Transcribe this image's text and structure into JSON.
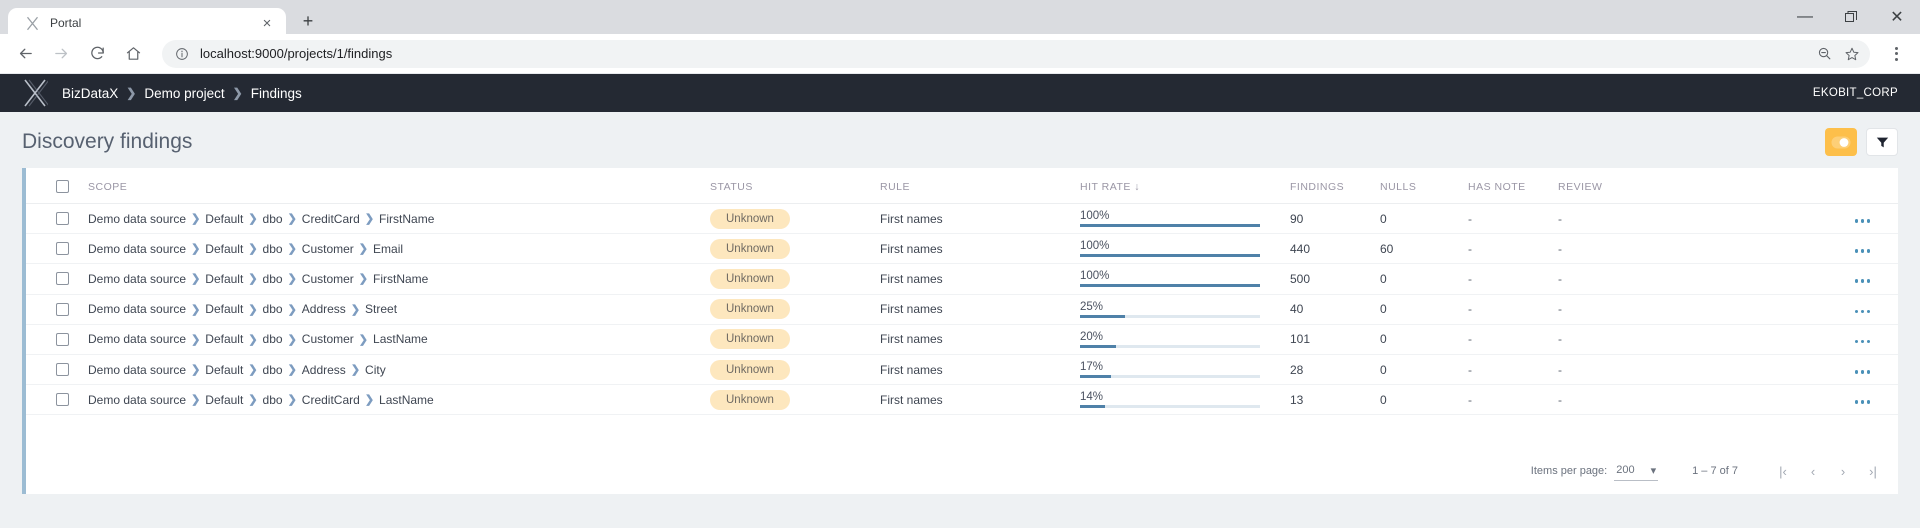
{
  "browser": {
    "tab_title": "Portal",
    "tab_favicon": "x-logo-icon",
    "close_tab_label": "×",
    "new_tab_label": "+",
    "url": "localhost:9000/projects/1/findings",
    "back_label": "←",
    "forward_label": "→",
    "reload_label": "⟳",
    "home_label": "⌂",
    "minimize_label": "—",
    "restore_label": "❐",
    "close_label": "✕"
  },
  "header": {
    "breadcrumb": [
      {
        "label": "BizDataX"
      },
      {
        "label": "Demo project"
      },
      {
        "label": "Findings"
      }
    ],
    "separator": "❯",
    "org": "EKOBIT_CORP"
  },
  "page": {
    "title": "Discovery findings",
    "toggle_button": "toggle-icon",
    "filter_button": "filter-icon",
    "accent_amber": "#fdbf4a",
    "accent_blue": "#4f81a8"
  },
  "table": {
    "columns": {
      "scope": "SCOPE",
      "status": "STATUS",
      "rule": "RULE",
      "hit_rate": "HIT RATE",
      "sort_indicator": "↓",
      "findings": "FINDINGS",
      "nulls": "NULLS",
      "has_note": "HAS NOTE",
      "review": "REVIEW"
    },
    "rows": [
      {
        "scope": [
          "Demo data source",
          "Default",
          "dbo",
          "CreditCard",
          "FirstName"
        ],
        "status": "Unknown",
        "rule": "First names",
        "hit_rate": "100%",
        "hit_rate_value": 100,
        "findings": "90",
        "nulls": "0",
        "has_note": "-",
        "review": "-"
      },
      {
        "scope": [
          "Demo data source",
          "Default",
          "dbo",
          "Customer",
          "Email"
        ],
        "status": "Unknown",
        "rule": "First names",
        "hit_rate": "100%",
        "hit_rate_value": 100,
        "findings": "440",
        "nulls": "60",
        "has_note": "-",
        "review": "-"
      },
      {
        "scope": [
          "Demo data source",
          "Default",
          "dbo",
          "Customer",
          "FirstName"
        ],
        "status": "Unknown",
        "rule": "First names",
        "hit_rate": "100%",
        "hit_rate_value": 100,
        "findings": "500",
        "nulls": "0",
        "has_note": "-",
        "review": "-"
      },
      {
        "scope": [
          "Demo data source",
          "Default",
          "dbo",
          "Address",
          "Street"
        ],
        "status": "Unknown",
        "rule": "First names",
        "hit_rate": "25%",
        "hit_rate_value": 25,
        "findings": "40",
        "nulls": "0",
        "has_note": "-",
        "review": "-"
      },
      {
        "scope": [
          "Demo data source",
          "Default",
          "dbo",
          "Customer",
          "LastName"
        ],
        "status": "Unknown",
        "rule": "First names",
        "hit_rate": "20%",
        "hit_rate_value": 20,
        "findings": "101",
        "nulls": "0",
        "has_note": "-",
        "review": "-"
      },
      {
        "scope": [
          "Demo data source",
          "Default",
          "dbo",
          "Address",
          "City"
        ],
        "status": "Unknown",
        "rule": "First names",
        "hit_rate": "17%",
        "hit_rate_value": 17,
        "findings": "28",
        "nulls": "0",
        "has_note": "-",
        "review": "-"
      },
      {
        "scope": [
          "Demo data source",
          "Default",
          "dbo",
          "CreditCard",
          "LastName"
        ],
        "status": "Unknown",
        "rule": "First names",
        "hit_rate": "14%",
        "hit_rate_value": 14,
        "findings": "13",
        "nulls": "0",
        "has_note": "-",
        "review": "-"
      }
    ],
    "row_menu": "more-actions-icon"
  },
  "paginator": {
    "items_per_page_label": "Items per page:",
    "items_per_page_value": "200",
    "dropdown_caret": "▾",
    "range_label": "1 – 7 of 7",
    "first_page": "|‹",
    "prev_page": "‹",
    "next_page": "›",
    "last_page": "›|"
  }
}
